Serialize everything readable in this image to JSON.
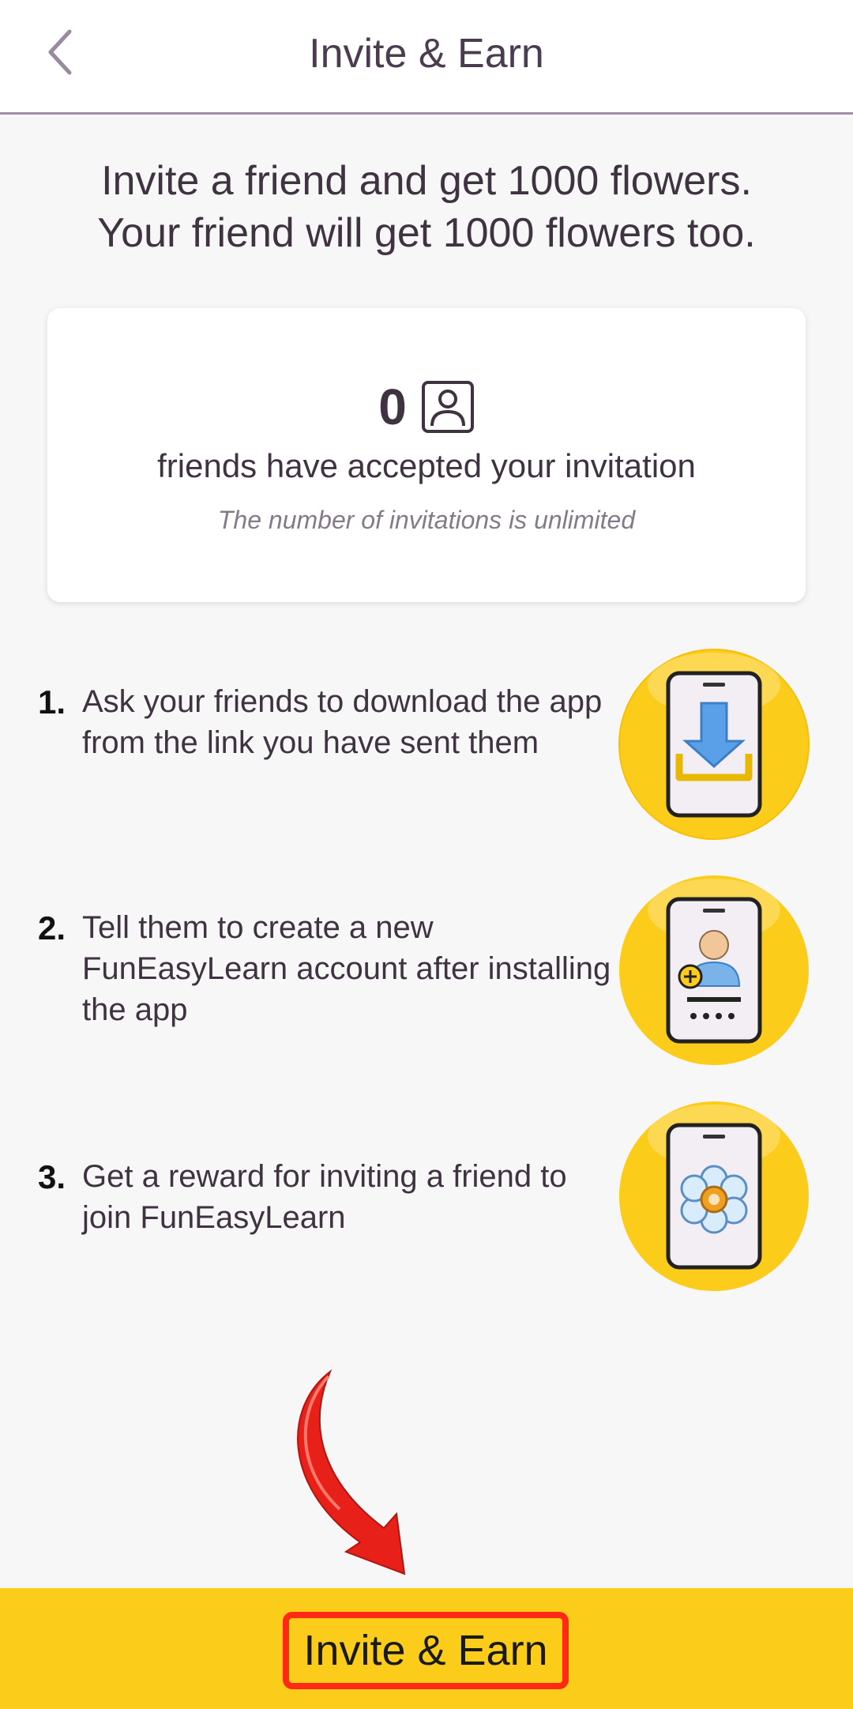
{
  "header": {
    "title": "Invite & Earn",
    "back_icon": "chevron-left-icon"
  },
  "intro": {
    "line1": "Invite a friend and get 1000 flowers.",
    "line2": "Your friend will get 1000 flowers too."
  },
  "stats": {
    "count": "0",
    "label": "friends have accepted your invitation",
    "note": "The number of invitations is unlimited",
    "icon": "person-icon"
  },
  "steps": [
    {
      "number": "1.",
      "text": "Ask your friends to download the app from the link you have sent them",
      "icon": "phone-download-icon"
    },
    {
      "number": "2.",
      "text": "Tell them to create a new FunEasyLearn account after installing the app",
      "icon": "phone-add-account-icon"
    },
    {
      "number": "3.",
      "text": "Get a reward for inviting a friend to join FunEasyLearn",
      "icon": "phone-flower-icon"
    }
  ],
  "footer": {
    "button_label": "Invite & Earn"
  },
  "colors": {
    "accent": "#fccc1a",
    "highlight": "#ff2a14",
    "text": "#3f3341"
  }
}
